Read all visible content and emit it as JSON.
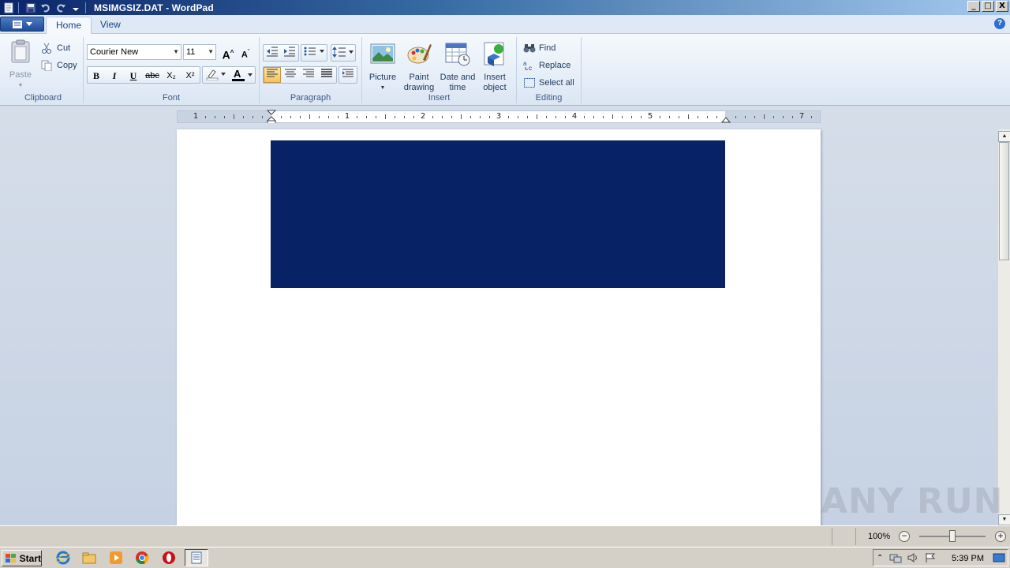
{
  "window": {
    "title": "MSIMGSIZ.DAT - WordPad",
    "controls": {
      "minimize": "_",
      "maximize": "□",
      "close": "X"
    }
  },
  "tabs": [
    {
      "label": "Home",
      "active": true
    },
    {
      "label": "View",
      "active": false
    }
  ],
  "ribbon": {
    "clipboard": {
      "label": "Clipboard",
      "paste": "Paste",
      "cut": "Cut",
      "copy": "Copy"
    },
    "font": {
      "label": "Font",
      "family": "Courier New",
      "size": "11",
      "bold": "B",
      "italic": "I",
      "underline": "U",
      "strike": "abc",
      "subscript": "X₂",
      "superscript": "X²"
    },
    "paragraph": {
      "label": "Paragraph",
      "active_alignment": "left"
    },
    "insert": {
      "label": "Insert",
      "picture": "Picture",
      "paint_1": "Paint",
      "paint_2": "drawing",
      "datetime_1": "Date and",
      "datetime_2": "time",
      "object_1": "Insert",
      "object_2": "object"
    },
    "editing": {
      "label": "Editing",
      "find": "Find",
      "replace": "Replace",
      "select_all": "Select all"
    }
  },
  "ruler": {
    "labels": [
      "1",
      "1",
      "2",
      "3",
      "4",
      "5",
      "7"
    ]
  },
  "document": {
    "embedded_image_color": "#082266"
  },
  "statusbar": {
    "zoom": "100%",
    "zoom_fraction": 0.5
  },
  "taskbar": {
    "start": "Start",
    "clock": "5:39 PM"
  },
  "watermark": "ANY RUN"
}
